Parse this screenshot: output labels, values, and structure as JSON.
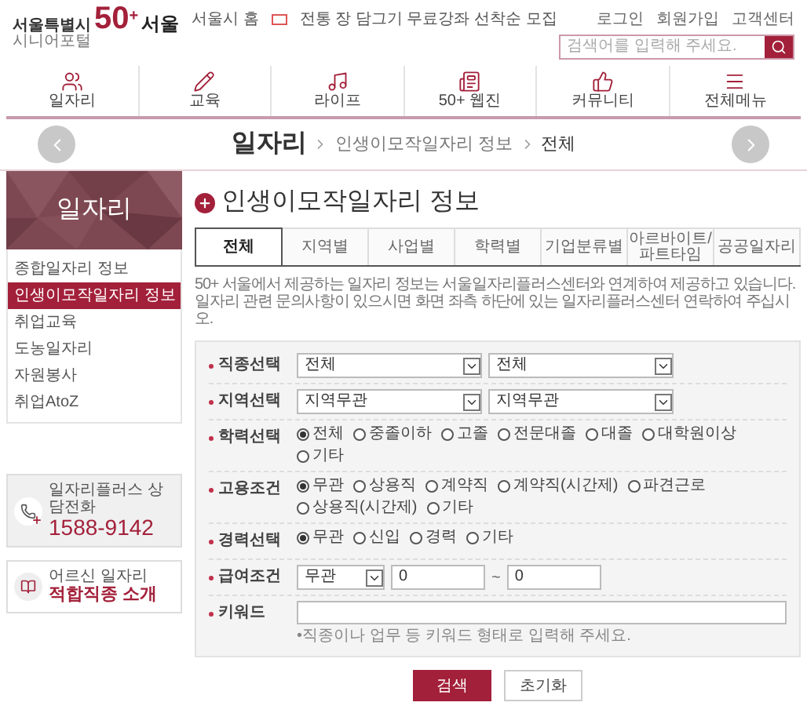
{
  "header": {
    "logo": {
      "top": "서울특별시",
      "sub": "시니어포털",
      "main": "50",
      "sup": "+",
      "city": "서울"
    },
    "home_link": "서울시 홈",
    "notice": "전통 장 담그기 무료강좌 선착순 모집",
    "links": [
      "로그인",
      "회원가입",
      "고객센터"
    ],
    "search": {
      "placeholder": "검색어를 입력해 주세요."
    }
  },
  "nav": [
    {
      "label": "일자리",
      "kind": "users"
    },
    {
      "label": "교육",
      "kind": "pencil"
    },
    {
      "label": "라이프",
      "kind": "music"
    },
    {
      "label": "50+ 웹진",
      "kind": "news"
    },
    {
      "label": "커뮤니티",
      "kind": "thumb"
    },
    {
      "label": "전체메뉴",
      "kind": "menu"
    }
  ],
  "breadcrumb": {
    "section": "일자리",
    "items": [
      "인생이모작일자리 정보",
      "전체"
    ]
  },
  "sidebar": {
    "title": "일자리",
    "items": [
      {
        "label": "종합일자리 정보",
        "selected": false
      },
      {
        "label": "인생이모작일자리 정보",
        "selected": true
      },
      {
        "label": "취업교육",
        "selected": false
      },
      {
        "label": "도농일자리",
        "selected": false
      },
      {
        "label": "자원봉사",
        "selected": false
      },
      {
        "label": "취업AtoZ",
        "selected": false
      }
    ],
    "phone": {
      "label": "일자리플러스 상담전화",
      "number": "1588-9142"
    },
    "guide": {
      "label": "어르신 일자리",
      "title": "적합직종 소개"
    }
  },
  "page_title": "인생이모작일자리 정보",
  "tabs": [
    {
      "label": "전체",
      "selected": true
    },
    {
      "label": "지역별",
      "selected": false
    },
    {
      "label": "사업별",
      "selected": false
    },
    {
      "label": "학력별",
      "selected": false
    },
    {
      "label": "기업분류별",
      "selected": false
    },
    {
      "label": "아르바이트/\n파트타임",
      "selected": false
    },
    {
      "label": "공공일자리",
      "selected": false
    }
  ],
  "description": [
    "50+ 서울에서 제공하는 일자리 정보는 서울일자리플러스센터와 연계하여 제공하고 있습니다.",
    "일자리 관련 문의사항이 있으시면 화면 좌측 하단에 있는 일자리플러스센터 연락하여 주십시오."
  ],
  "filters": [
    {
      "label": "직종선택",
      "kind": "select",
      "values": [
        "전체",
        "전체"
      ]
    },
    {
      "label": "지역선택",
      "kind": "select",
      "values": [
        "지역무관",
        "지역무관"
      ]
    },
    {
      "label": "학력선택",
      "kind": "radio",
      "options": [
        {
          "label": "전체",
          "selected": true
        },
        {
          "label": "중졸이하",
          "selected": false
        },
        {
          "label": "고졸",
          "selected": false
        },
        {
          "label": "전문대졸",
          "selected": false
        },
        {
          "label": "대졸",
          "selected": false
        },
        {
          "label": "대학원이상",
          "selected": false
        },
        {
          "label": "기타",
          "selected": false
        }
      ]
    },
    {
      "label": "고용조건",
      "kind": "radio",
      "options": [
        {
          "label": "무관",
          "selected": true
        },
        {
          "label": "상용직",
          "selected": false
        },
        {
          "label": "계약직",
          "selected": false
        },
        {
          "label": "계약직(시간제)",
          "selected": false
        },
        {
          "label": "파견근로",
          "selected": false
        },
        {
          "label": "상용직(시간제)",
          "selected": false
        },
        {
          "label": "기타",
          "selected": false
        }
      ]
    },
    {
      "label": "경력선택",
      "kind": "radio",
      "options": [
        {
          "label": "무관",
          "selected": true
        },
        {
          "label": "신입",
          "selected": false
        },
        {
          "label": "경력",
          "selected": false
        },
        {
          "label": "기타",
          "selected": false
        }
      ]
    },
    {
      "label": "급여조건",
      "kind": "salary",
      "select": "무관",
      "from": "0",
      "separator": "~",
      "to": "0"
    },
    {
      "label": "키워드",
      "kind": "keyword",
      "hint": "•직종이나 업무 등 키워드 형태로 입력해 주세요."
    }
  ],
  "buttons": [
    {
      "label": "검색",
      "primary": true
    },
    {
      "label": "초기화",
      "primary": false
    }
  ]
}
